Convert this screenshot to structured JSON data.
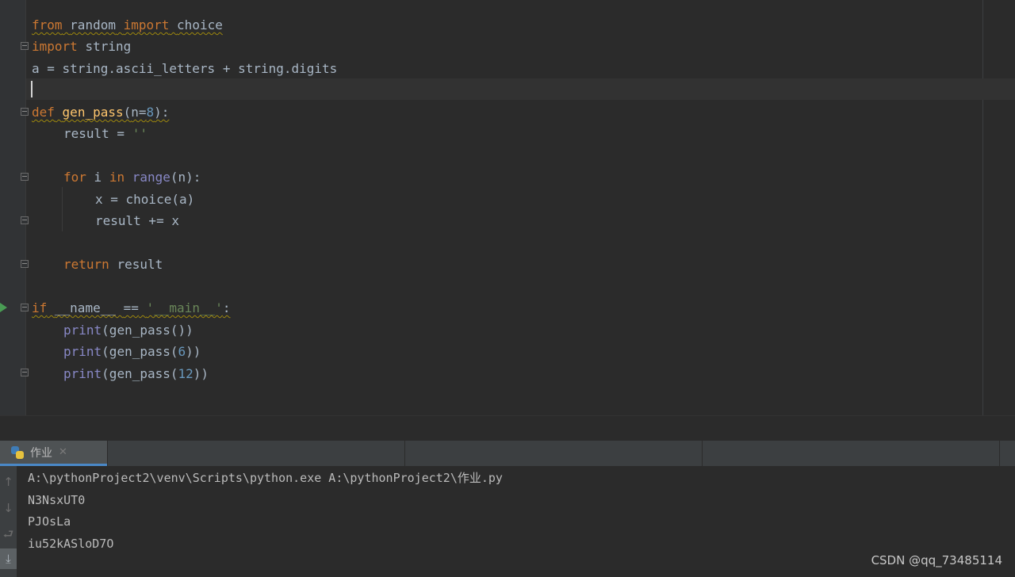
{
  "editor": {
    "line1": {
      "kw1": "from",
      "module": "random",
      "kw2": "import",
      "name": "choice"
    },
    "line2": {
      "kw": "import",
      "module": "string"
    },
    "line3": {
      "text": "a = string.ascii_letters + string.digits"
    },
    "line5": {
      "kw": "def",
      "fn": "gen_pass",
      "open": "(",
      "param": "n=",
      "num": "8",
      "close": "):"
    },
    "line6": {
      "text": "result = ",
      "str": "''"
    },
    "line8": {
      "kw1": "for",
      "var": "i",
      "kw2": "in",
      "builtin": "range",
      "rest": "(n):"
    },
    "line9": {
      "text": "x = choice(a)"
    },
    "line10": {
      "text": "result += x"
    },
    "line12": {
      "kw": "return",
      "text": "result"
    },
    "line14": {
      "kw": "if",
      "name": "__name__",
      "op": "==",
      "str": "'__main__'",
      "colon": ":"
    },
    "line15": {
      "builtin": "print",
      "rest": "(gen_pass())"
    },
    "line16": {
      "builtin": "print",
      "open": "(gen_pass(",
      "num": "6",
      "close": "))"
    },
    "line17": {
      "builtin": "print",
      "open": "(gen_pass(",
      "num": "12",
      "close": "))"
    }
  },
  "run_panel": {
    "tab_label": "作业",
    "tab_close": "✕",
    "tool_icons": {
      "up": "↑",
      "down": "↓",
      "wrap": "⮐",
      "scroll_end": "⤓"
    },
    "console": [
      "A:\\pythonProject2\\venv\\Scripts\\python.exe A:\\pythonProject2\\作业.py",
      "N3NsxUT0",
      "PJOsLa",
      "iu52kASloD7O"
    ]
  },
  "watermark": "CSDN @qq_73485114",
  "colors": {
    "background": "#2b2b2b",
    "keyword": "#cc7832",
    "function": "#ffc66d",
    "builtin": "#8888c6",
    "number": "#6897bb",
    "string": "#6a8759",
    "text": "#a9b7c6"
  },
  "icons": {
    "run_gutter": "run-icon",
    "tab": "python-icon"
  }
}
